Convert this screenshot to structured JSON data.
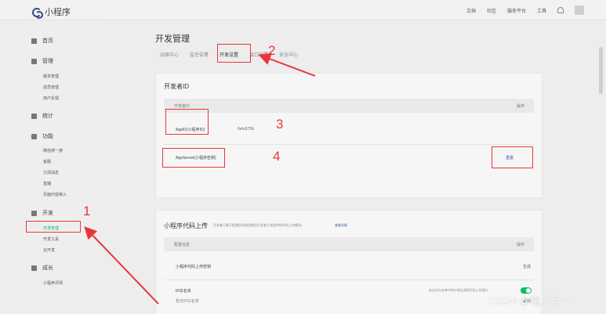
{
  "app": {
    "title": "小程序"
  },
  "topnav": {
    "items": [
      "文档",
      "社区",
      "服务平台",
      "工具"
    ]
  },
  "sidebar": {
    "groups": [
      {
        "label": "首页"
      },
      {
        "label": "管理"
      },
      {
        "label": "统计"
      },
      {
        "label": "功能"
      },
      {
        "label": "开发"
      },
      {
        "label": "成长"
      }
    ],
    "manage_items": [
      "版本管理",
      "成员管理",
      "用户反馈"
    ],
    "function_items": [
      "微信搜一搜",
      "客服",
      "订阅消息",
      "直播",
      "页面内容接入"
    ],
    "dev_items": [
      "开发管理",
      "开发工具",
      "云开发"
    ],
    "growth_items": [
      "小程序评测"
    ]
  },
  "main": {
    "page_title": "开发管理",
    "tabs": [
      "运维中心",
      "监控告警",
      "开发设置",
      "接口设置",
      "安全中心"
    ]
  },
  "dev_id_card": {
    "title": "开发者ID",
    "col_info": "开发者ID",
    "col_action": "操作",
    "appid_label": "AppID(小程序ID)",
    "appid_value": "6efe573b",
    "secret_label": "AppSecret(小程序密钥)",
    "reset_label": "重置"
  },
  "upload_card": {
    "title": "小程序代码上传",
    "desc": "开发者可基于配置信息调用微信开发者工具提供的代码上传模块。",
    "desc_link": "查看详情",
    "col_config": "配置信息",
    "col_action": "操作",
    "row1": "小程序代码上传密钥",
    "row1_action": "生成",
    "row2": "IP白名单",
    "row2_note": "仅允许白名单中的IP地址调用代码上传接口",
    "row3": "暂无IP白名单",
    "row3_action": "编辑"
  },
  "annotations": [
    "1",
    "2",
    "3",
    "4"
  ],
  "watermark": "CSDN @曦月合一",
  "colors": {
    "accent": "#07c160",
    "annotation": "#e8363b",
    "link": "#3a5a9a"
  }
}
